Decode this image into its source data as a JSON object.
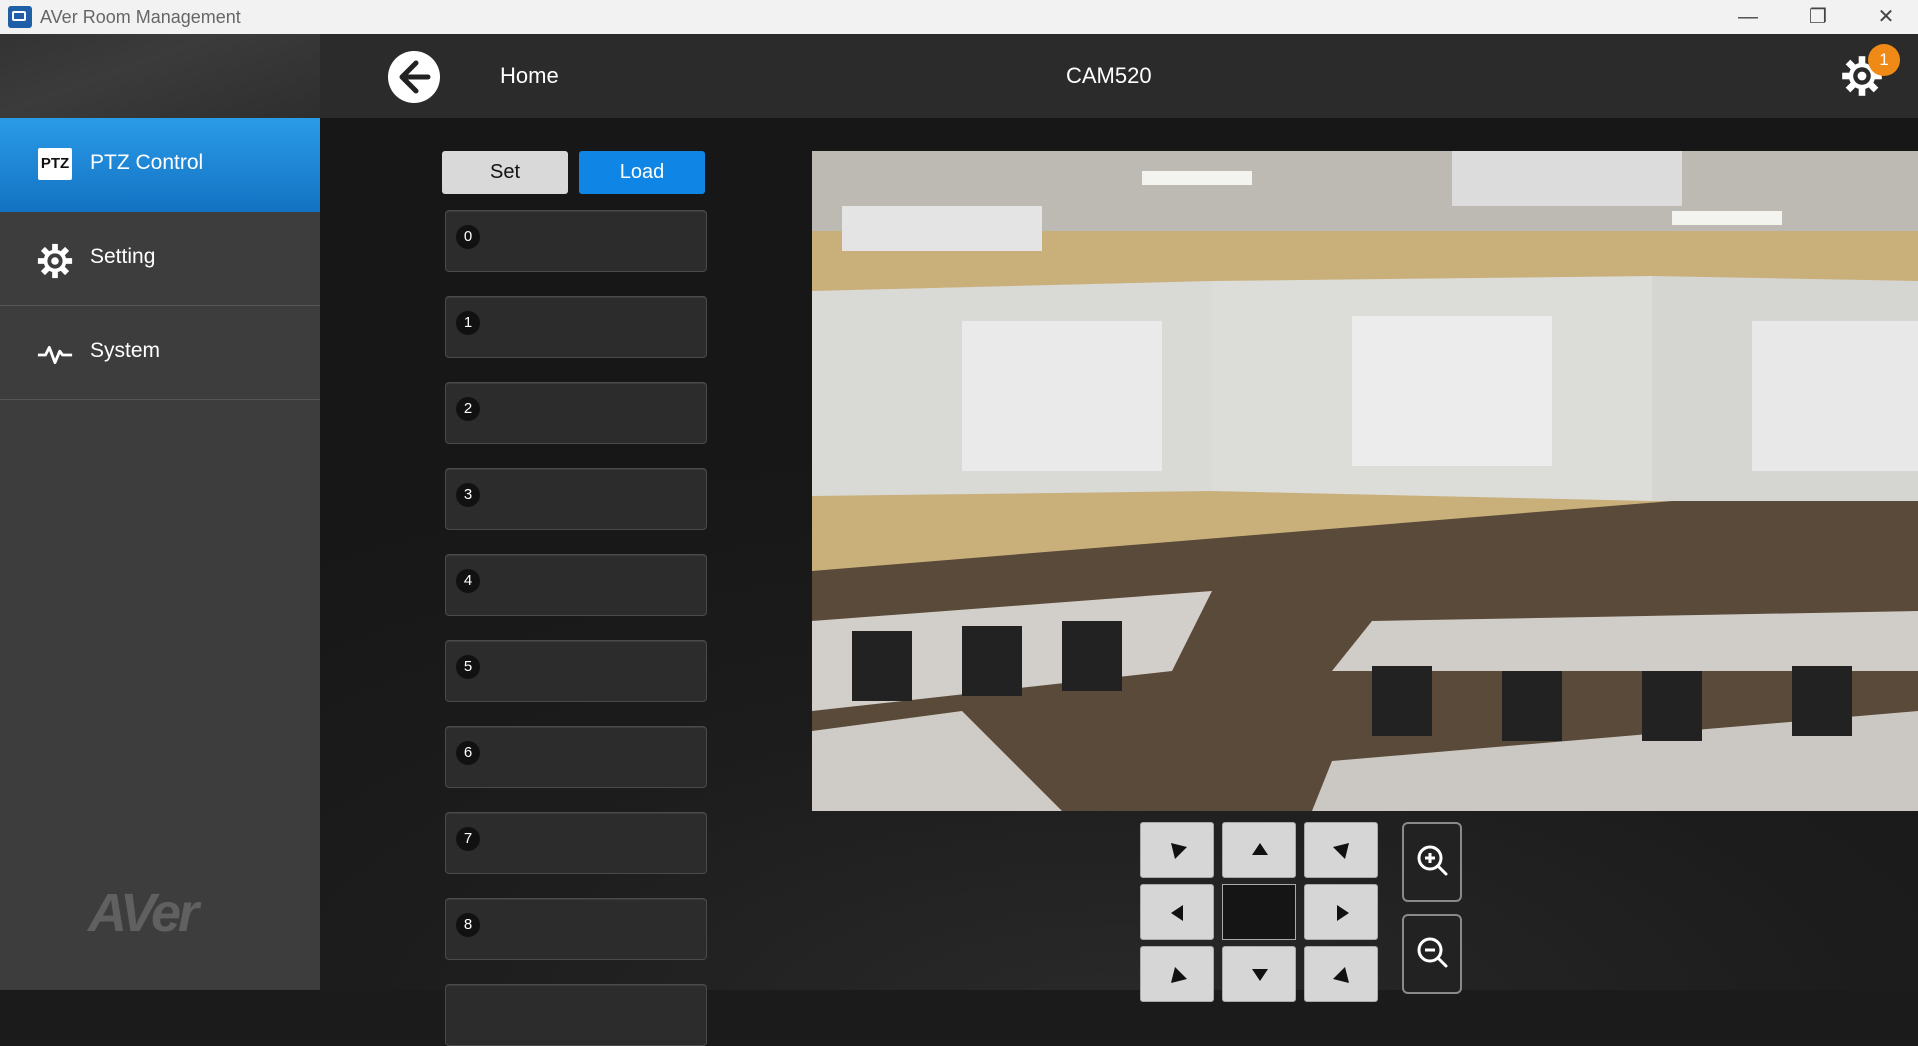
{
  "window": {
    "title": "AVer Room Management",
    "minimize": "—",
    "restore": "❐",
    "close": "✕"
  },
  "sidebar": {
    "items": [
      {
        "label": "PTZ Control",
        "icon": "ptz-icon",
        "badge": "PTZ",
        "active": true
      },
      {
        "label": "Setting",
        "icon": "gear-icon",
        "active": false
      },
      {
        "label": "System",
        "icon": "pulse-icon",
        "active": false
      }
    ],
    "logo": "AVer"
  },
  "header": {
    "home_label": "Home",
    "camera_name": "CAM520",
    "notification_count": "1"
  },
  "presets": {
    "set_label": "Set",
    "load_label": "Load",
    "items": [
      "0",
      "1",
      "2",
      "3",
      "4",
      "5",
      "6",
      "7",
      "8"
    ]
  },
  "colors": {
    "accent": "#0f86e6",
    "notification": "#f08a16",
    "sidebar_bg": "#3d3d3d"
  }
}
